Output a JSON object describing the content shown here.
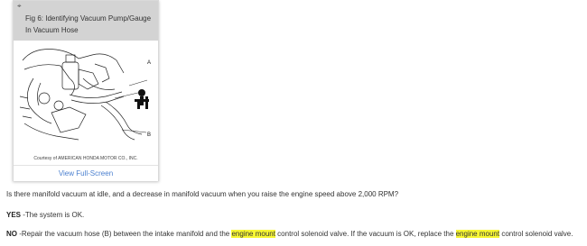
{
  "figure": {
    "caption": "Fig 6: Identifying Vacuum Pump/Gauge In Vacuum Hose",
    "credit": "Courtesy of AMERICAN HONDA MOTOR CO., INC.",
    "view_link": "View Full-Screen",
    "labels": {
      "a": "A",
      "b": "B"
    },
    "zoom_icon": "magnify-icon"
  },
  "question": "Is there manifold vacuum at idle, and a decrease in manifold vacuum when you raise the engine speed above 2,000 RPM?",
  "yes": {
    "label": "YES",
    "text": " -The system is OK."
  },
  "no": {
    "label": "NO",
    "text_1": " -Repair the vacuum hose (B) between the intake manifold and the ",
    "highlight_1": "engine mount",
    "text_2": " control solenoid valve. If the vacuum is OK, replace the ",
    "highlight_2": "engine mount",
    "text_3": " control solenoid valve."
  },
  "colors": {
    "highlight": "#f7f734",
    "link": "#4a7fcf",
    "header_bg": "#d3d3d3"
  }
}
